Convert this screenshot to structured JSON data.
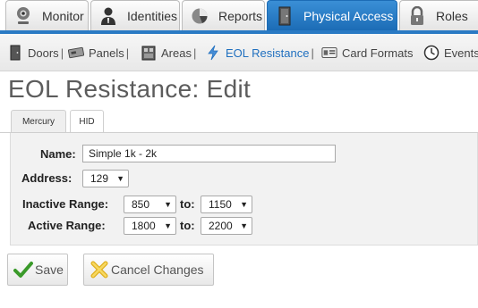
{
  "top_tabs": [
    {
      "label": "Monitor",
      "icon": "webcam-icon"
    },
    {
      "label": "Identities",
      "icon": "person-icon"
    },
    {
      "label": "Reports",
      "icon": "pie-chart-icon"
    },
    {
      "label": "Physical Access",
      "icon": "door-icon",
      "active": true
    },
    {
      "label": "Roles",
      "icon": "lock-icon"
    }
  ],
  "sub_nav": [
    {
      "label": "Doors",
      "sep": "|"
    },
    {
      "label": "Panels",
      "sep": "|"
    },
    {
      "label": "Areas",
      "sep": "|"
    },
    {
      "label": "EOL Resistance",
      "sep": "|",
      "active": true
    },
    {
      "label": "Card Formats",
      "sep": ""
    },
    {
      "label": "Events",
      "sep": ""
    }
  ],
  "page": {
    "title": "EOL Resistance: Edit"
  },
  "content_tabs": [
    {
      "label": "Mercury"
    },
    {
      "label": "HID",
      "active": true
    }
  ],
  "form": {
    "name_label": "Name:",
    "name_value": "Simple 1k - 2k",
    "address_label": "Address:",
    "address_value": "129",
    "inactive_label": "Inactive Range:",
    "inactive_from": "850",
    "inactive_to_label": "to:",
    "inactive_to": "1150",
    "active_label": "Active Range:",
    "active_from": "1800",
    "active_to_label": "to:",
    "active_to": "2200"
  },
  "buttons": {
    "save_label": "Save",
    "cancel_label": "Cancel Changes"
  },
  "colors": {
    "accent": "#1f6fbf",
    "active_tab": "#2a7ac4"
  }
}
